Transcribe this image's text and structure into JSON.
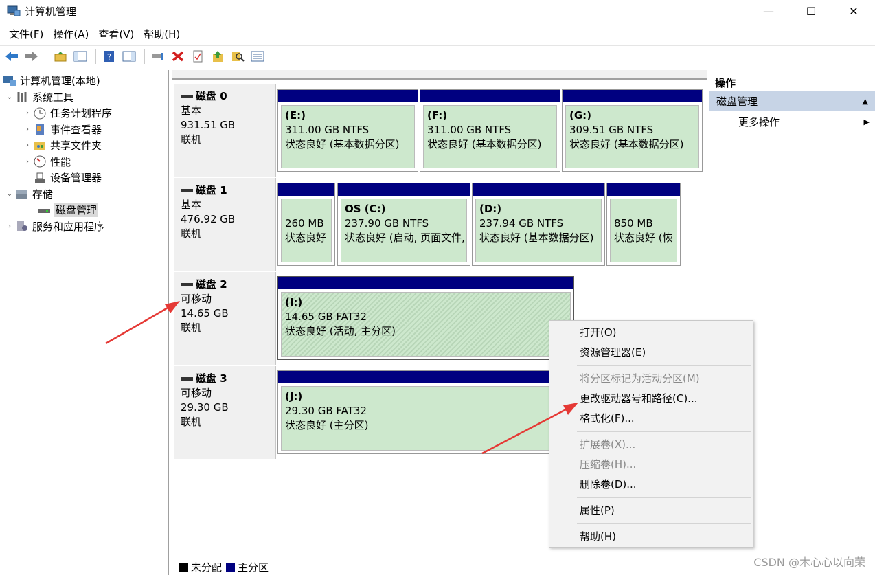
{
  "window": {
    "title": "计算机管理",
    "controls": {
      "minimize": "—",
      "maximize": "☐",
      "close": "✕"
    }
  },
  "menu": [
    "文件(F)",
    "操作(A)",
    "查看(V)",
    "帮助(H)"
  ],
  "tree": {
    "root": "计算机管理(本地)",
    "system_tools": "系统工具",
    "task_scheduler": "任务计划程序",
    "event_viewer": "事件查看器",
    "shared_folders": "共享文件夹",
    "performance": "性能",
    "device_manager": "设备管理器",
    "storage": "存储",
    "disk_management": "磁盘管理",
    "services_apps": "服务和应用程序"
  },
  "disks": [
    {
      "name": "磁盘 0",
      "type": "基本",
      "size": "931.51 GB",
      "status": "联机",
      "partitions": [
        {
          "drive": "(E:)",
          "size": "311.00 GB NTFS",
          "status": "状态良好 (基本数据分区)"
        },
        {
          "drive": "(F:)",
          "size": "311.00 GB NTFS",
          "status": "状态良好 (基本数据分区)"
        },
        {
          "drive": "(G:)",
          "size": "309.51 GB NTFS",
          "status": "状态良好 (基本数据分区)"
        }
      ]
    },
    {
      "name": "磁盘 1",
      "type": "基本",
      "size": "476.92 GB",
      "status": "联机",
      "partitions": [
        {
          "drive": "",
          "size": "260 MB",
          "status": "状态良好"
        },
        {
          "drive": "OS  (C:)",
          "size": "237.90 GB NTFS",
          "status": "状态良好 (启动, 页面文件,"
        },
        {
          "drive": "(D:)",
          "size": "237.94 GB NTFS",
          "status": "状态良好 (基本数据分区)"
        },
        {
          "drive": "",
          "size": "850 MB",
          "status": "状态良好 (恢"
        }
      ]
    },
    {
      "name": "磁盘 2",
      "type": "可移动",
      "size": "14.65 GB",
      "status": "联机",
      "partitions": [
        {
          "drive": "(I:)",
          "size": "14.65 GB FAT32",
          "status": "状态良好 (活动, 主分区)"
        }
      ]
    },
    {
      "name": "磁盘 3",
      "type": "可移动",
      "size": "29.30 GB",
      "status": "联机",
      "partitions": [
        {
          "drive": "(J:)",
          "size": "29.30 GB FAT32",
          "status": "状态良好 (主分区)"
        }
      ]
    }
  ],
  "legend": {
    "unallocated": "未分配",
    "primary": "主分区"
  },
  "actions": {
    "header": "操作",
    "section": "磁盘管理",
    "more": "更多操作"
  },
  "context_menu": {
    "open": "打开(O)",
    "explorer": "资源管理器(E)",
    "mark_active": "将分区标记为活动分区(M)",
    "change_letter": "更改驱动器号和路径(C)...",
    "format": "格式化(F)...",
    "extend": "扩展卷(X)...",
    "shrink": "压缩卷(H)...",
    "delete": "删除卷(D)...",
    "properties": "属性(P)",
    "help": "帮助(H)"
  },
  "watermark": "CSDN @木心心以向荣",
  "colors": {
    "primary_partition_bar": "#000080",
    "partition_fill": "#cde8cd",
    "selection": "#c7d4e6",
    "annotation_arrow": "#e53935"
  }
}
